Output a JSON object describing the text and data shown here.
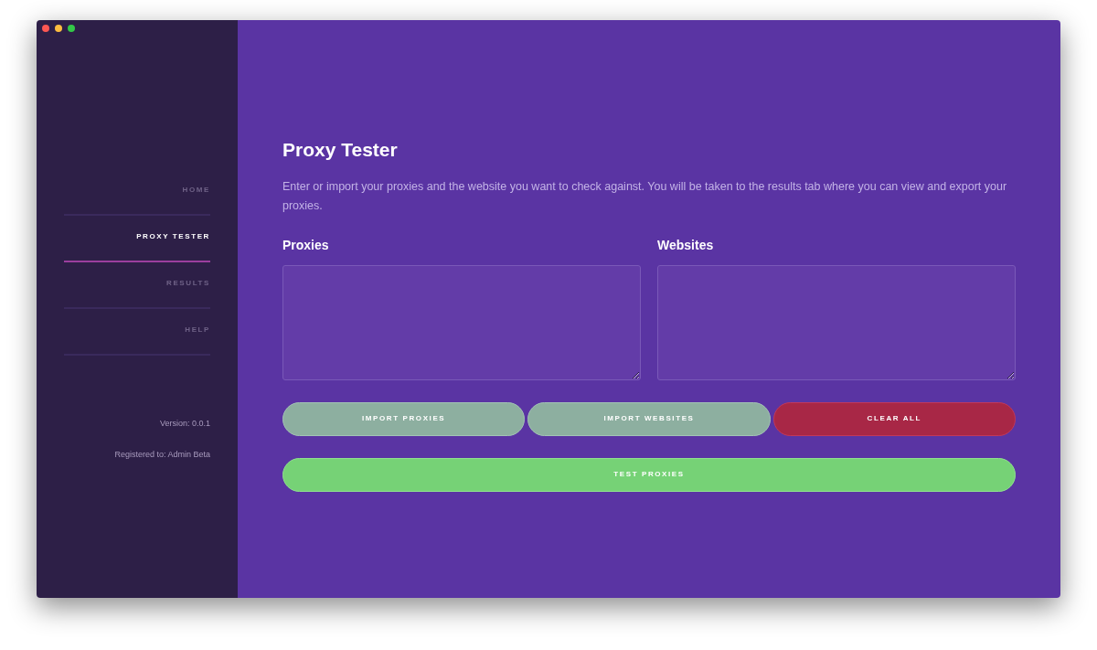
{
  "sidebar": {
    "items": [
      {
        "label": "HOME",
        "selected": false
      },
      {
        "label": "PROXY TESTER",
        "selected": true
      },
      {
        "label": "RESULTS",
        "selected": false
      },
      {
        "label": "HELP",
        "selected": false
      }
    ],
    "version": "Version: 0.0.1",
    "registered": "Registered to: Admin Beta"
  },
  "main": {
    "title": "Proxy Tester",
    "description": "Enter or import your proxies and the website you want to check against. You will be taken to the results tab where you can view and export your proxies.",
    "fields": [
      {
        "label": "Proxies"
      },
      {
        "label": "Websites"
      }
    ],
    "buttons": [
      {
        "label": "IMPORT PROXIES",
        "kind": "import"
      },
      {
        "label": "IMPORT WEBSITES",
        "kind": "import"
      },
      {
        "label": "CLEAR ALL",
        "kind": "danger"
      }
    ],
    "primary_button": {
      "label": "TEST PROXIES"
    }
  }
}
